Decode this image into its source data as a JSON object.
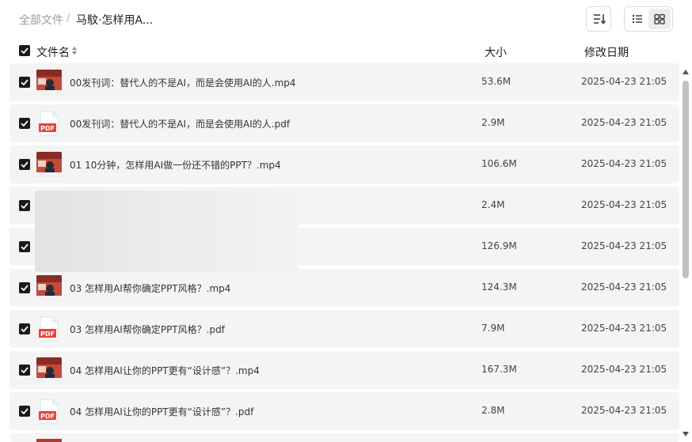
{
  "breadcrumb": {
    "root": "全部文件",
    "separator": "/",
    "current": "马馼·怎样用A..."
  },
  "header": {
    "name": "文件名",
    "size": "大小",
    "date": "修改日期"
  },
  "colors": {
    "row_bg": "#f4f4f5",
    "checkbox": "#1a1a1a",
    "pdf_red": "#e8413a"
  },
  "files": [
    {
      "name": "00发刊词：替代人的不是AI，而是会使用AI的人.mp4",
      "size": "53.6M",
      "date": "2025-04-23 21:05",
      "type": "video"
    },
    {
      "name": "00发刊词：替代人的不是AI，而是会使用AI的人.pdf",
      "size": "2.9M",
      "date": "2025-04-23 21:05",
      "type": "pdf"
    },
    {
      "name": "01 10分钟，怎样用AI做一份还不错的PPT？.mp4",
      "size": "106.6M",
      "date": "2025-04-23 21:05",
      "type": "video"
    },
    {
      "name": "",
      "size": "2.4M",
      "date": "2025-04-23 21:05",
      "type": "hidden"
    },
    {
      "name": "",
      "size": "126.9M",
      "date": "2025-04-23 21:05",
      "type": "hidden"
    },
    {
      "name": "03 怎样用AI帮你确定PPT风格？.mp4",
      "size": "124.3M",
      "date": "2025-04-23 21:05",
      "type": "video"
    },
    {
      "name": "03 怎样用AI帮你确定PPT风格？.pdf",
      "size": "7.9M",
      "date": "2025-04-23 21:05",
      "type": "pdf"
    },
    {
      "name": "04 怎样用AI让你的PPT更有“设计感”？.mp4",
      "size": "167.3M",
      "date": "2025-04-23 21:05",
      "type": "video"
    },
    {
      "name": "04 怎样用AI让你的PPT更有“设计感”？.pdf",
      "size": "2.8M",
      "date": "2025-04-23 21:05",
      "type": "pdf"
    }
  ],
  "pdf_label": "PDF"
}
